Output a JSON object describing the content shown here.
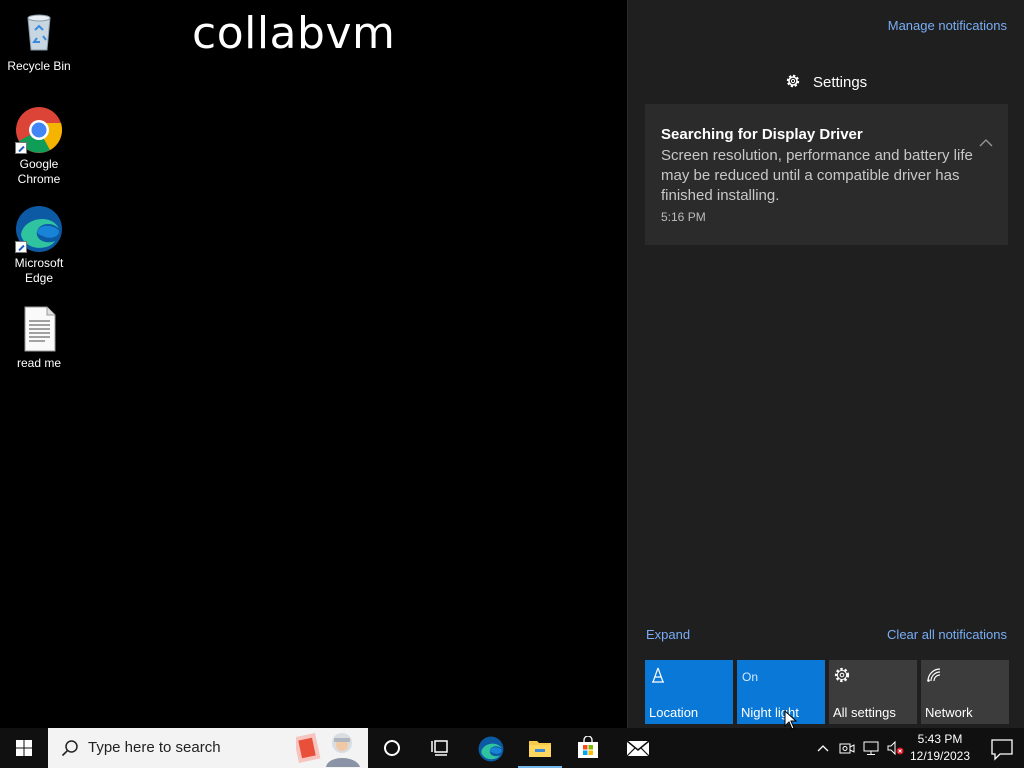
{
  "desktop": {
    "watermark": "collabvm",
    "icons": [
      {
        "label": "Recycle Bin",
        "icon": "recycle-bin-icon"
      },
      {
        "label": "Google Chrome",
        "icon": "chrome-icon"
      },
      {
        "label": "Microsoft Edge",
        "icon": "edge-icon"
      },
      {
        "label": "read me",
        "icon": "text-document-icon"
      }
    ]
  },
  "action_center": {
    "manage_notifications": "Manage notifications",
    "group_header": "Settings",
    "notification": {
      "title": "Searching for Display Driver",
      "body": "Screen resolution, performance and battery life may be reduced until a compatible driver has finished installing.",
      "time": "5:16 PM"
    },
    "expand": "Expand",
    "clear_all": "Clear all notifications",
    "quick_actions": [
      {
        "label": "Location",
        "state": "",
        "active": true,
        "icon": "location-icon"
      },
      {
        "label": "Night light",
        "state": "On",
        "active": true,
        "icon": "night-light-icon"
      },
      {
        "label": "All settings",
        "state": "",
        "active": false,
        "icon": "gear-icon"
      },
      {
        "label": "Network",
        "state": "",
        "active": false,
        "icon": "network-icon"
      }
    ]
  },
  "taskbar": {
    "search_placeholder": "Type here to search",
    "pinned": [
      "cortana-icon",
      "task-view-icon",
      "edge-icon",
      "file-explorer-icon",
      "store-icon",
      "mail-icon"
    ],
    "clock": {
      "time": "5:43 PM",
      "date": "12/19/2023"
    }
  },
  "colors": {
    "accent": "#0a78d7",
    "link": "#79aef5",
    "panel": "#1f1f1f",
    "card": "#2b2b2b"
  }
}
